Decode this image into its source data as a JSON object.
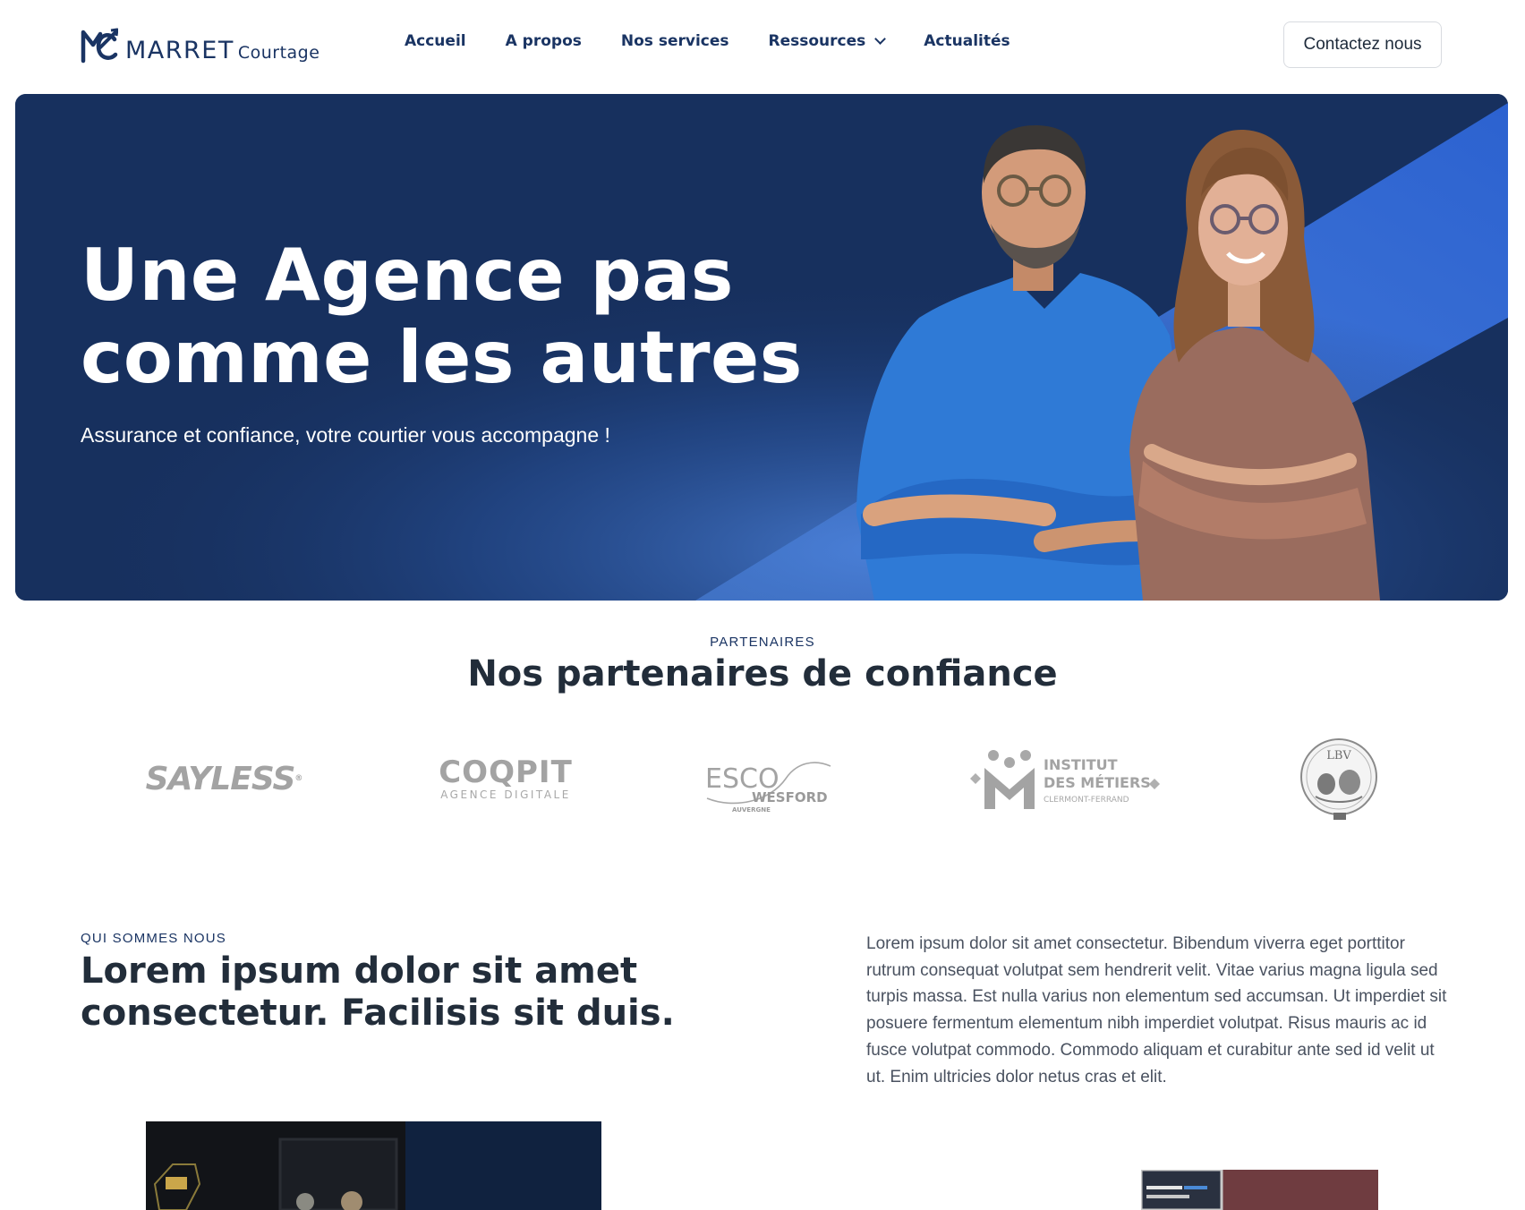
{
  "header": {
    "logo": {
      "name": "MARRET",
      "sub": "Courtage"
    },
    "nav": [
      {
        "label": "Accueil"
      },
      {
        "label": "A propos"
      },
      {
        "label": "Nos services"
      },
      {
        "label": "Ressources",
        "has_dropdown": true
      },
      {
        "label": "Actualités"
      }
    ],
    "contact_label": "Contactez nous"
  },
  "hero": {
    "title_line1": "Une Agence pas",
    "title_line2": "comme les autres",
    "subtitle": "Assurance et confiance, votre courtier vous accompagne !"
  },
  "partners": {
    "eyebrow": "PARTENAIRES",
    "title": "Nos partenaires de confiance",
    "logos": {
      "sayless": "SAYLESS",
      "coqpit": "COQPIT",
      "coqpit_sub": "AGENCE DIGITALE",
      "esco": "ESCO",
      "wesford": "WESFORD",
      "auvergne": "AUVERGNE",
      "institut_l1": "INSTITUT",
      "institut_l2": "DES MÉTIERS",
      "institut_l3": "CLERMONT-FERRAND",
      "lbv": "LBV"
    }
  },
  "about": {
    "eyebrow": "QUI SOMMES NOUS",
    "title": "Lorem ipsum dolor sit amet consectetur. Facilisis sit duis.",
    "text": "Lorem ipsum dolor sit amet consectetur. Bibendum viverra eget porttitor rutrum consequat volutpat sem hendrerit velit. Vitae varius magna ligula sed turpis massa. Est nulla varius non elementum sed accumsan. Ut imperdiet sit posuere fermentum elementum nibh imperdiet volutpat. Risus mauris ac id fusce volutpat commodo. Commodo aliquam et curabitur ante sed id velit ut ut. Enim ultricies dolor netus cras et elit."
  },
  "colors": {
    "brand_navy": "#1a3463",
    "hero_bg": "#17305e",
    "hero_accent": "#2f63d1",
    "text_dark": "#222d3a",
    "text_body": "#4a5260",
    "logo_gray": "#a3a3a3"
  },
  "icons": [
    "marret-logo-icon",
    "chevron-down-icon"
  ]
}
